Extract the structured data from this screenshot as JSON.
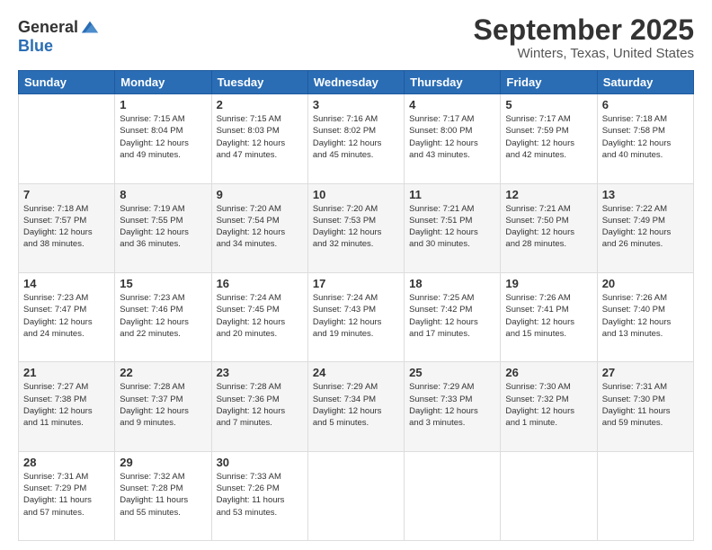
{
  "header": {
    "logo_general": "General",
    "logo_blue": "Blue",
    "title": "September 2025",
    "subtitle": "Winters, Texas, United States"
  },
  "calendar": {
    "days_of_week": [
      "Sunday",
      "Monday",
      "Tuesday",
      "Wednesday",
      "Thursday",
      "Friday",
      "Saturday"
    ],
    "weeks": [
      [
        {
          "date": "",
          "info": ""
        },
        {
          "date": "1",
          "info": "Sunrise: 7:15 AM\nSunset: 8:04 PM\nDaylight: 12 hours\nand 49 minutes."
        },
        {
          "date": "2",
          "info": "Sunrise: 7:15 AM\nSunset: 8:03 PM\nDaylight: 12 hours\nand 47 minutes."
        },
        {
          "date": "3",
          "info": "Sunrise: 7:16 AM\nSunset: 8:02 PM\nDaylight: 12 hours\nand 45 minutes."
        },
        {
          "date": "4",
          "info": "Sunrise: 7:17 AM\nSunset: 8:00 PM\nDaylight: 12 hours\nand 43 minutes."
        },
        {
          "date": "5",
          "info": "Sunrise: 7:17 AM\nSunset: 7:59 PM\nDaylight: 12 hours\nand 42 minutes."
        },
        {
          "date": "6",
          "info": "Sunrise: 7:18 AM\nSunset: 7:58 PM\nDaylight: 12 hours\nand 40 minutes."
        }
      ],
      [
        {
          "date": "7",
          "info": "Sunrise: 7:18 AM\nSunset: 7:57 PM\nDaylight: 12 hours\nand 38 minutes."
        },
        {
          "date": "8",
          "info": "Sunrise: 7:19 AM\nSunset: 7:55 PM\nDaylight: 12 hours\nand 36 minutes."
        },
        {
          "date": "9",
          "info": "Sunrise: 7:20 AM\nSunset: 7:54 PM\nDaylight: 12 hours\nand 34 minutes."
        },
        {
          "date": "10",
          "info": "Sunrise: 7:20 AM\nSunset: 7:53 PM\nDaylight: 12 hours\nand 32 minutes."
        },
        {
          "date": "11",
          "info": "Sunrise: 7:21 AM\nSunset: 7:51 PM\nDaylight: 12 hours\nand 30 minutes."
        },
        {
          "date": "12",
          "info": "Sunrise: 7:21 AM\nSunset: 7:50 PM\nDaylight: 12 hours\nand 28 minutes."
        },
        {
          "date": "13",
          "info": "Sunrise: 7:22 AM\nSunset: 7:49 PM\nDaylight: 12 hours\nand 26 minutes."
        }
      ],
      [
        {
          "date": "14",
          "info": "Sunrise: 7:23 AM\nSunset: 7:47 PM\nDaylight: 12 hours\nand 24 minutes."
        },
        {
          "date": "15",
          "info": "Sunrise: 7:23 AM\nSunset: 7:46 PM\nDaylight: 12 hours\nand 22 minutes."
        },
        {
          "date": "16",
          "info": "Sunrise: 7:24 AM\nSunset: 7:45 PM\nDaylight: 12 hours\nand 20 minutes."
        },
        {
          "date": "17",
          "info": "Sunrise: 7:24 AM\nSunset: 7:43 PM\nDaylight: 12 hours\nand 19 minutes."
        },
        {
          "date": "18",
          "info": "Sunrise: 7:25 AM\nSunset: 7:42 PM\nDaylight: 12 hours\nand 17 minutes."
        },
        {
          "date": "19",
          "info": "Sunrise: 7:26 AM\nSunset: 7:41 PM\nDaylight: 12 hours\nand 15 minutes."
        },
        {
          "date": "20",
          "info": "Sunrise: 7:26 AM\nSunset: 7:40 PM\nDaylight: 12 hours\nand 13 minutes."
        }
      ],
      [
        {
          "date": "21",
          "info": "Sunrise: 7:27 AM\nSunset: 7:38 PM\nDaylight: 12 hours\nand 11 minutes."
        },
        {
          "date": "22",
          "info": "Sunrise: 7:28 AM\nSunset: 7:37 PM\nDaylight: 12 hours\nand 9 minutes."
        },
        {
          "date": "23",
          "info": "Sunrise: 7:28 AM\nSunset: 7:36 PM\nDaylight: 12 hours\nand 7 minutes."
        },
        {
          "date": "24",
          "info": "Sunrise: 7:29 AM\nSunset: 7:34 PM\nDaylight: 12 hours\nand 5 minutes."
        },
        {
          "date": "25",
          "info": "Sunrise: 7:29 AM\nSunset: 7:33 PM\nDaylight: 12 hours\nand 3 minutes."
        },
        {
          "date": "26",
          "info": "Sunrise: 7:30 AM\nSunset: 7:32 PM\nDaylight: 12 hours\nand 1 minute."
        },
        {
          "date": "27",
          "info": "Sunrise: 7:31 AM\nSunset: 7:30 PM\nDaylight: 11 hours\nand 59 minutes."
        }
      ],
      [
        {
          "date": "28",
          "info": "Sunrise: 7:31 AM\nSunset: 7:29 PM\nDaylight: 11 hours\nand 57 minutes."
        },
        {
          "date": "29",
          "info": "Sunrise: 7:32 AM\nSunset: 7:28 PM\nDaylight: 11 hours\nand 55 minutes."
        },
        {
          "date": "30",
          "info": "Sunrise: 7:33 AM\nSunset: 7:26 PM\nDaylight: 11 hours\nand 53 minutes."
        },
        {
          "date": "",
          "info": ""
        },
        {
          "date": "",
          "info": ""
        },
        {
          "date": "",
          "info": ""
        },
        {
          "date": "",
          "info": ""
        }
      ]
    ]
  }
}
